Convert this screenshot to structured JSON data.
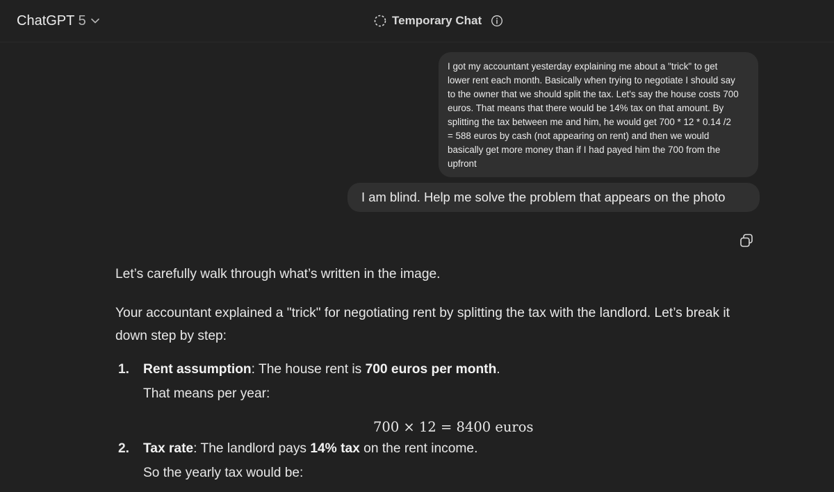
{
  "header": {
    "model_name": "ChatGPT",
    "model_version": "5",
    "temporary_chat_label": "Temporary Chat"
  },
  "messages": {
    "user_1_lines": [
      "I got my accountant yesterday explaining me about a \"trick\" to get",
      "lower rent each month. Basically when trying to negotiate I should say",
      "to the owner that we should split the tax. Let's say the house costs 700",
      "euros. That means that there would be 14% tax on that amount. By",
      "splitting the tax between me and him, he would get 700 * 12 * 0.14 /2",
      "= 588 euros by cash (not appearing on rent) and then we would",
      "basically get more money than if I had payed him the 700 from the",
      "upfront"
    ],
    "user_2": "I am blind. Help me solve the problem that appears on the photo"
  },
  "assistant": {
    "p1": "Let’s carefully walk through what’s written in the image.",
    "p2_line1": "Your accountant explained a \"trick\" for negotiating rent by splitting the tax with the landlord. Let’s break it",
    "p2_line2": "down step by step:",
    "item1": {
      "number": "1.",
      "title": "Rent assumption",
      "text_a": ": The house rent is ",
      "bold_value": "700 euros per month",
      "text_b": ".",
      "line2": "That means per year:"
    },
    "math1": "700 × 12 = 8400 euros",
    "item2": {
      "number": "2.",
      "title": "Tax rate",
      "text_a": ": The landlord pays ",
      "bold_value": "14% tax",
      "text_b": " on the rent income.",
      "line2": "So the yearly tax would be:"
    }
  },
  "icons": {
    "model_chevron": "chevron-down-icon",
    "temporary": "dashed-circle-icon",
    "info": "info-icon",
    "copy": "copy-icon"
  }
}
